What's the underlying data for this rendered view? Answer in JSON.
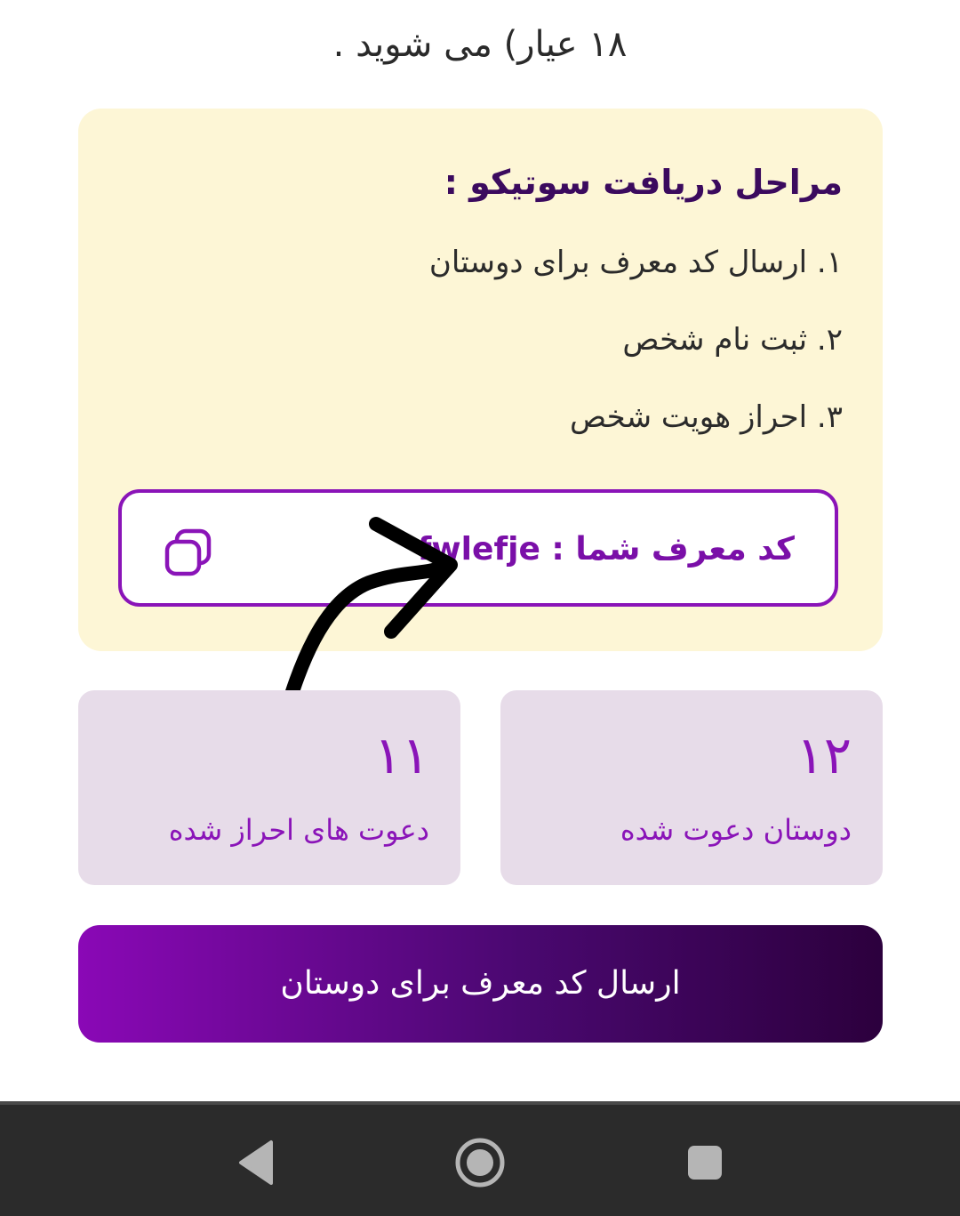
{
  "intro": {
    "last_line": "۱۸ عیار) می شوید ."
  },
  "steps": {
    "title": "مراحل دریافت سوتیکو :",
    "items": [
      "۱. ارسال کد معرف برای دوستان",
      "۲. ثبت نام شخص",
      "۳. احراز هویت شخص"
    ]
  },
  "referral": {
    "label": "کد معرف شما : ",
    "code": "fwlefje",
    "copy_icon": "copy-icon"
  },
  "stats": {
    "invited": {
      "value": "۱۲",
      "label": "دوستان دعوت شده"
    },
    "verified": {
      "value": "۱۱",
      "label": "دعوت های احراز شده"
    }
  },
  "send_button": {
    "label": "ارسال کد معرف برای دوستان"
  },
  "nav": {
    "back_icon": "triangle-back-icon",
    "home_icon": "circle-home-icon",
    "recent_icon": "square-recents-icon"
  },
  "colors": {
    "accent": "#8a14b8",
    "card_bg": "#fdf6d6",
    "stat_bg": "#e7dce9",
    "title": "#3b0a5e"
  }
}
